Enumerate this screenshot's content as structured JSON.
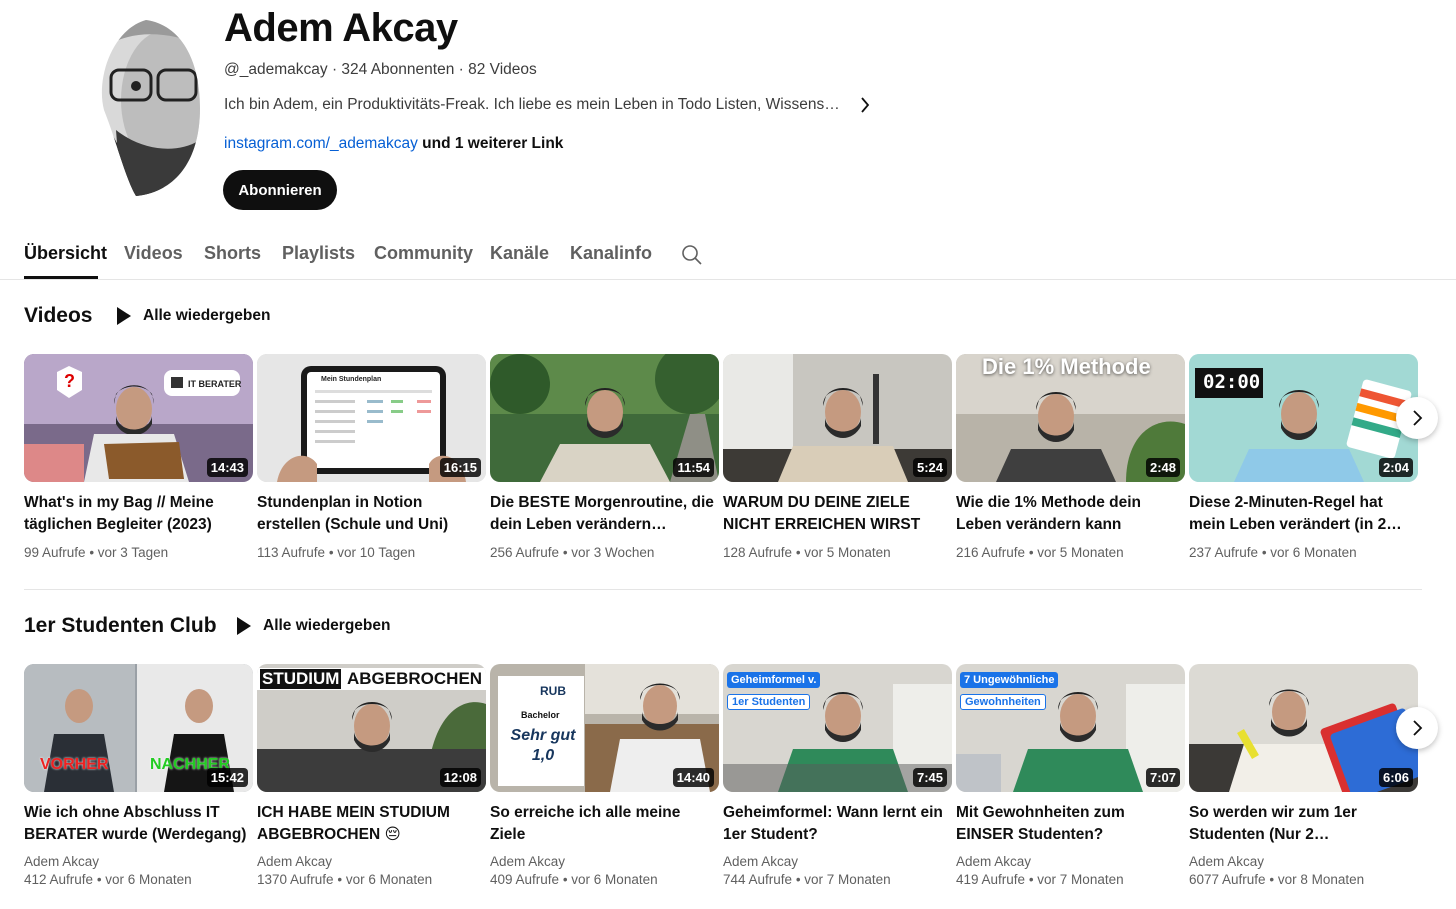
{
  "channel": {
    "name": "Adem Akcay",
    "handle": "@_ademakcay",
    "subscribers": "324 Abonnenten",
    "video_count": "82 Videos",
    "description": "Ich bin Adem, ein Produktivitäts-Freak. Ich liebe es mein Leben in Todo Listen, Wissensdatenbanken und Systemen zu organisieren",
    "link": "instagram.com/_ademakcay",
    "more_links": "und 1 weiterer Link",
    "subscribe_label": "Abonnieren"
  },
  "tabs": [
    {
      "label": "Übersicht"
    },
    {
      "label": "Videos"
    },
    {
      "label": "Shorts"
    },
    {
      "label": "Playlists"
    },
    {
      "label": "Community"
    },
    {
      "label": "Kanäle"
    },
    {
      "label": "Kanalinfo"
    }
  ],
  "sections": [
    {
      "title": "Videos",
      "play_all": "Alle wiedergeben",
      "videos": [
        {
          "title": "What's in my Bag // Meine täglichen Begleiter (2023)",
          "duration": "14:43",
          "views": "99 Aufrufe",
          "age": "vor 3 Tagen",
          "overlay": "IT BERATER"
        },
        {
          "title": "Stundenplan in Notion erstellen (Schule und Uni)",
          "duration": "16:15",
          "views": "113 Aufrufe",
          "age": "vor 10 Tagen",
          "overlay": "Mein Stundenplan"
        },
        {
          "title": "Die BESTE Morgenroutine, die dein Leben verändern…",
          "duration": "11:54",
          "views": "256 Aufrufe",
          "age": "vor 3 Wochen",
          "overlay": ""
        },
        {
          "title": "WARUM DU DEINE ZIELE NICHT ERREICHEN WIRST",
          "duration": "5:24",
          "views": "128 Aufrufe",
          "age": "vor 5 Monaten",
          "overlay": ""
        },
        {
          "title": "Wie die 1% Methode dein Leben verändern kann",
          "duration": "2:48",
          "views": "216 Aufrufe",
          "age": "vor 5 Monaten",
          "overlay": "Die 1% Methode"
        },
        {
          "title": "Diese 2-Minuten-Regel hat mein Leben verändert (in 2…",
          "duration": "2:04",
          "views": "237 Aufrufe",
          "age": "vor 6 Monaten",
          "overlay": "02:00"
        }
      ]
    },
    {
      "title": "1er Studenten Club",
      "play_all": "Alle wiedergeben",
      "videos": [
        {
          "title": "Wie ich ohne Abschluss IT BERATER wurde (Werdegang)",
          "duration": "15:42",
          "channel": "Adem Akcay",
          "views": "412 Aufrufe",
          "age": "vor 6 Monaten",
          "overlay": "VORHER",
          "overlay2": "NACHHER"
        },
        {
          "title": "ICH HABE MEIN STUDIUM ABGEBROCHEN 😔",
          "duration": "12:08",
          "channel": "Adem Akcay",
          "views": "1370 Aufrufe",
          "age": "vor 6 Monaten",
          "overlay": "STUDIUM",
          "overlay2": "ABGEBROCHEN"
        },
        {
          "title": "So erreiche ich alle meine Ziele",
          "duration": "14:40",
          "channel": "Adem Akcay",
          "views": "409 Aufrufe",
          "age": "vor 6 Monaten",
          "overlay": "RUB",
          "overlay2": "Bachelor",
          "overlay3": "Sehr gut 1,0"
        },
        {
          "title": "Geheimformel: Wann lernt ein 1er Student?",
          "duration": "7:45",
          "channel": "Adem Akcay",
          "views": "744 Aufrufe",
          "age": "vor 7 Monaten",
          "overlay": "Geheimformel v.",
          "overlay2": "1er Studenten"
        },
        {
          "title": "Mit Gewohnheiten zum EINSER Studenten?",
          "duration": "7:07",
          "channel": "Adem Akcay",
          "views": "419 Aufrufe",
          "age": "vor 7 Monaten",
          "overlay": "7 Ungewöhnliche",
          "overlay2": "Gewohnheiten"
        },
        {
          "title": "So werden wir zum 1er Studenten (Nur 2…",
          "duration": "6:06",
          "channel": "Adem Akcay",
          "views": "6077 Aufrufe",
          "age": "vor 8 Monaten",
          "overlay": ""
        }
      ]
    }
  ],
  "colors": {
    "text": "#0f0f0f",
    "secondary": "#606060",
    "link": "#065fd4",
    "divider": "#e5e5e5"
  }
}
